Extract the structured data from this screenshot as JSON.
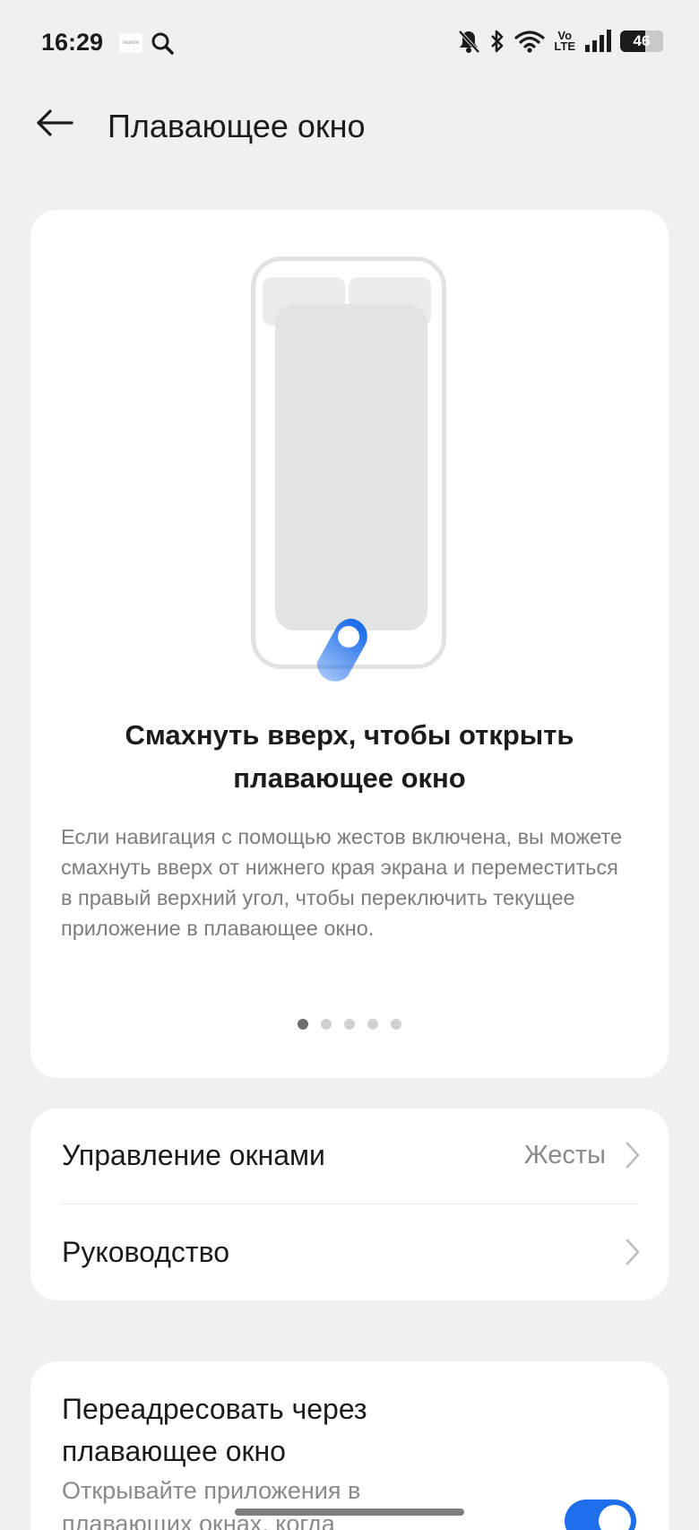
{
  "status_bar": {
    "time": "16:29",
    "battery_level": "46",
    "icons": [
      "app-badge-icon",
      "search-icon",
      "mute-bell-icon",
      "bluetooth-icon",
      "wifi-icon",
      "volte-icon",
      "signal-icon",
      "battery-icon"
    ],
    "volte_top": "Vo",
    "volte_bottom": "LTE"
  },
  "header": {
    "title": "Плавающее окно"
  },
  "tutorial_card": {
    "headline": "Смахнуть вверх, чтобы открыть плавающее окно",
    "description": "Если навигация с помощью жестов включена, вы можете смахнуть вверх от нижнего края экрана и переместиться в правый верхний угол, чтобы переключить текущее приложение в плавающее окно.",
    "page_count": 5,
    "active_page": 1,
    "accent_color": "#1f6feb"
  },
  "settings": {
    "items": [
      {
        "label": "Управление окнами",
        "value": "Жесты"
      },
      {
        "label": "Руководство",
        "value": ""
      }
    ]
  },
  "redirect": {
    "title": "Переадресовать через плавающее окно",
    "description": "Открывайте приложения в плавающих окнах, когда",
    "enabled": true
  }
}
